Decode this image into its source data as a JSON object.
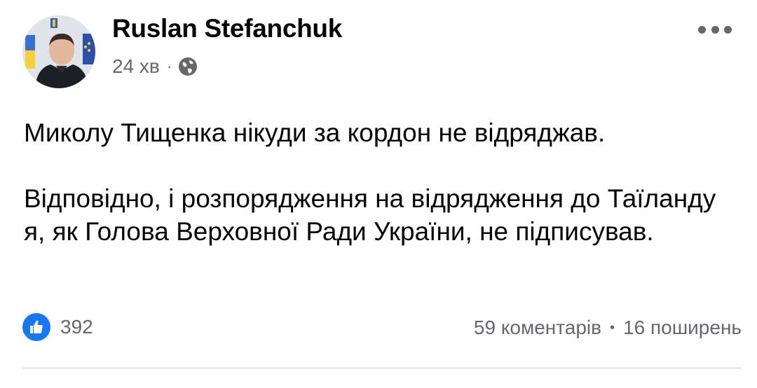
{
  "post": {
    "author": "Ruslan Stefanchuk",
    "time": "24 хв",
    "separator": "·",
    "privacy_icon": "globe-icon",
    "more_icon": "more-options-icon",
    "paragraphs": [
      "Миколу Тищенка нікуди за кордон не відряджав.",
      "Відповідно, і розпорядження на відрядження до Таїланду я, як Голова Верховної Ради України, не підписував."
    ],
    "reactions": {
      "icon": "like-icon",
      "count": "392"
    },
    "comments": "59 коментарів",
    "stats_separator": "•",
    "shares": "16 поширень"
  },
  "colors": {
    "like_blue": "#1877f2",
    "secondary_text": "#65676b",
    "primary_text": "#050505"
  }
}
